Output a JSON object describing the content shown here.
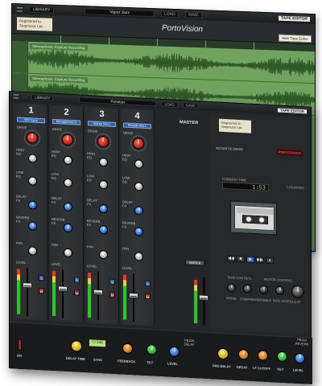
{
  "back_window": {
    "toolbar": {
      "library_label": "LIBRARY",
      "preset_name": "Vapor Jazz",
      "load_label": "LOAD",
      "save_label": "SAVE",
      "tape_badge": "TAPE EDITOR"
    },
    "registration_note": "Registered to Stopmusic Ltd.",
    "logo_text": "PortoVision",
    "tooltip": "Hide Tape Editor",
    "tracks": [
      {
        "label": "Stereophonic Capture Recording"
      },
      {
        "label": "Stereophonic Capture Recording"
      }
    ]
  },
  "front_window": {
    "toolbar": {
      "library_label": "LIBRARY",
      "title": "Portobox",
      "load_label": "LOAD",
      "save_label": "SAVE",
      "tape_badge": "TAPE EDITOR"
    },
    "channels": [
      {
        "number": "1",
        "source": "MIX Input"
      },
      {
        "number": "2",
        "source": "Microphones D"
      },
      {
        "number": "3",
        "source": "Stereo Vox L"
      },
      {
        "number": "4",
        "source": "Reverb Wet L"
      }
    ],
    "channel_labels": {
      "drive": "DRIVE",
      "high_eq": "HIGH EQ",
      "low_eq": "LOW EQ",
      "delay_fx": "DELAY FX",
      "reverb_fx": "REVERB FX",
      "pan": "PAN",
      "level": "LEVEL",
      "solo": "S",
      "mute": "M"
    },
    "master_label": "MASTER",
    "master_button": "MASTER",
    "right_panel": {
      "registration_note": "Registered to Stopmusic Ltd.",
      "brand_left": "ACOUSTIC DRIVE",
      "brand_right": "PORTODIGICO",
      "current_time_label": "CURRENT TIME",
      "current_time": "1:53",
      "locators_label": "LOCATORS",
      "tape_control_label": "TAPE CONTROL",
      "motor_control_label": "MOTOR CONTROL",
      "knob_labels": [
        "NOISE",
        "COMPRESS",
        "WOBBLE",
        "TAPE SPEED",
        "LO-FI"
      ],
      "transport": [
        "◀◀",
        "■",
        "▶",
        "▶▶",
        "●"
      ]
    },
    "fx": {
      "on_label": "ON",
      "lcd_value": "1/16D",
      "left_units": [
        "DELAY TIME",
        "SYNC",
        "FEEDBACK",
        "TILT",
        "LEVEL"
      ],
      "left_brand": "PB104 DELAY",
      "right_units": [
        "PRE-DELAY",
        "DECAY",
        "LF CUTOFF",
        "TILT",
        "LEVEL"
      ],
      "right_brand": "PB114 REVERB"
    }
  }
}
